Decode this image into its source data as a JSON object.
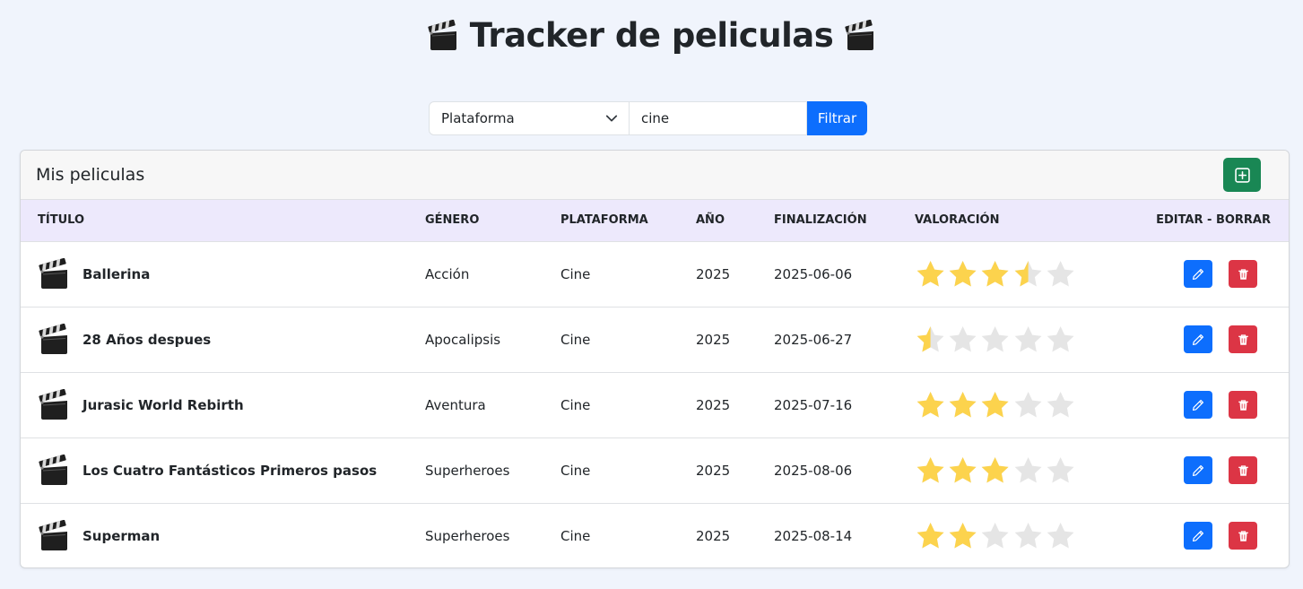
{
  "header": {
    "title": "Tracker de peliculas"
  },
  "filter": {
    "platform_select_value": "Plataforma",
    "search_value": "cine",
    "filter_button_label": "Filtrar"
  },
  "card": {
    "title": "Mis peliculas"
  },
  "table": {
    "columns": [
      "TÍTULO",
      "GÉNERO",
      "PLATAFORMA",
      "AÑO",
      "FINALIZACIÓN",
      "VALORACIÓN",
      "EDITAR - BORRAR"
    ],
    "rows": [
      {
        "title": "Ballerina",
        "genre": "Acción",
        "platform": "Cine",
        "year": "2025",
        "finished": "2025-06-06",
        "rating": 3.5
      },
      {
        "title": "28 Años despues",
        "genre": "Apocalipsis",
        "platform": "Cine",
        "year": "2025",
        "finished": "2025-06-27",
        "rating": 0.5
      },
      {
        "title": "Jurasic World Rebirth",
        "genre": "Aventura",
        "platform": "Cine",
        "year": "2025",
        "finished": "2025-07-16",
        "rating": 3
      },
      {
        "title": "Los Cuatro Fantásticos Primeros pasos",
        "genre": "Superheroes",
        "platform": "Cine",
        "year": "2025",
        "finished": "2025-08-06",
        "rating": 3
      },
      {
        "title": "Superman",
        "genre": "Superheroes",
        "platform": "Cine",
        "year": "2025",
        "finished": "2025-08-14",
        "rating": 2
      }
    ]
  },
  "colors": {
    "star_filled": "#fcd34d",
    "star_empty": "#e5e5e5",
    "primary": "#0d6efd",
    "success": "#198754",
    "danger": "#dc3545"
  },
  "icons": {
    "row_icon": "clapperboard-icon",
    "edit": "pencil-icon",
    "delete": "trash-icon",
    "add": "plus-square-icon"
  }
}
